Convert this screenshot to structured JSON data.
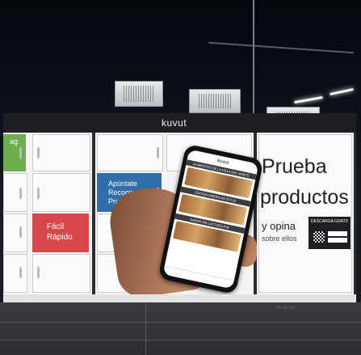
{
  "kiosk": {
    "brand": "kuvut",
    "tiles": {
      "green_text": "ag",
      "blue_lines": [
        "Apúntate",
        "Recoge",
        "Prueba"
      ],
      "red_lines": [
        "Fácil",
        "Rápido"
      ]
    },
    "headline_1": "Prueba",
    "headline_2": "productos",
    "subline_1": "y opina",
    "subline_2": "sobre ellos",
    "qr_caption": "DESCARGA GRATIS LA APP"
  },
  "phone": {
    "app_name": "kuvut",
    "banner_1": "ALIMENTOS DE LA VILLA DEL NORTE",
    "banner_2": "EDITION AMERICAN STYLE",
    "banner_3": "SABOR SIN LACTOSA P.M."
  },
  "colors": {
    "green": "#6dae4c",
    "blue": "#2f6ea8",
    "red": "#d8474a"
  }
}
